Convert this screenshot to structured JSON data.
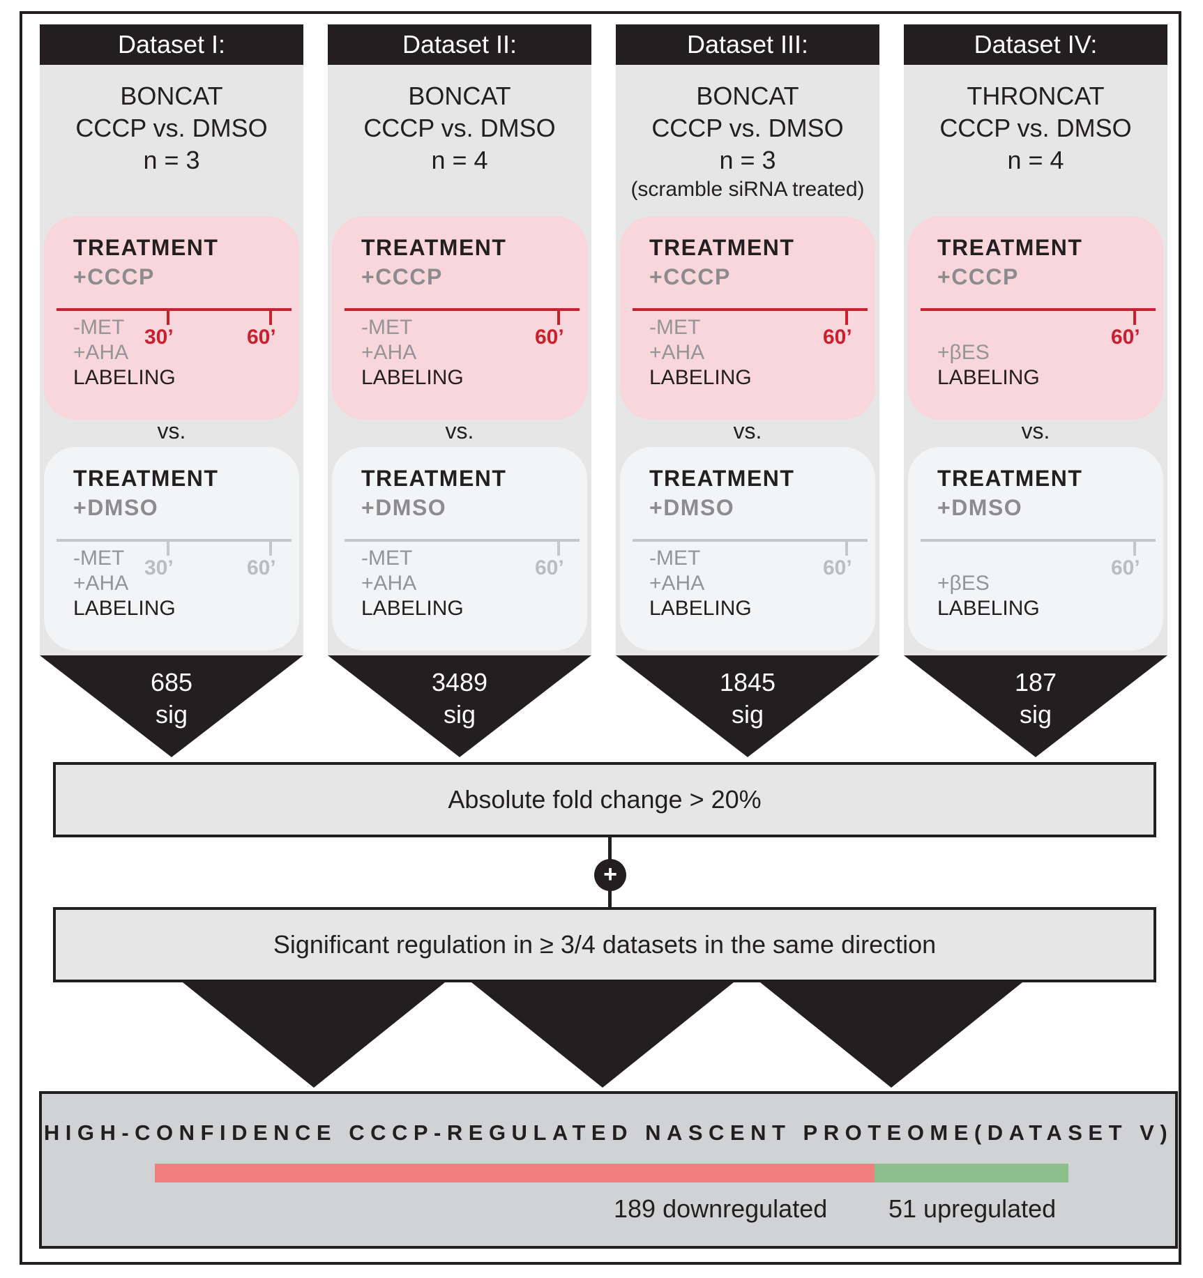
{
  "datasets": [
    {
      "header": "Dataset I:",
      "method": "BONCAT",
      "comparison": "CCCP vs. DMSO",
      "n": "n = 3",
      "note": "",
      "cccp": {
        "title": "TREATMENT",
        "agent": "+CCCP",
        "label_lines": [
          "-MET",
          "+AHA",
          "LABELING"
        ],
        "times": [
          "30’",
          "60’"
        ]
      },
      "vs": "vs.",
      "dmso": {
        "title": "TREATMENT",
        "agent": "+DMSO",
        "label_lines": [
          "-MET",
          "+AHA",
          "LABELING"
        ],
        "times": [
          "30’",
          "60’"
        ]
      },
      "sig_count": "685",
      "sig_label": "sig"
    },
    {
      "header": "Dataset II:",
      "method": "BONCAT",
      "comparison": "CCCP vs. DMSO",
      "n": "n = 4",
      "note": "",
      "cccp": {
        "title": "TREATMENT",
        "agent": "+CCCP",
        "label_lines": [
          "-MET",
          "+AHA",
          "LABELING"
        ],
        "times": [
          "60’"
        ]
      },
      "vs": "vs.",
      "dmso": {
        "title": "TREATMENT",
        "agent": "+DMSO",
        "label_lines": [
          "-MET",
          "+AHA",
          "LABELING"
        ],
        "times": [
          "60’"
        ]
      },
      "sig_count": "3489",
      "sig_label": "sig"
    },
    {
      "header": "Dataset III:",
      "method": "BONCAT",
      "comparison": "CCCP vs. DMSO",
      "n": "n = 3",
      "note": "(scramble siRNA treated)",
      "cccp": {
        "title": "TREATMENT",
        "agent": "+CCCP",
        "label_lines": [
          "-MET",
          "+AHA",
          "LABELING"
        ],
        "times": [
          "60’"
        ]
      },
      "vs": "vs.",
      "dmso": {
        "title": "TREATMENT",
        "agent": "+DMSO",
        "label_lines": [
          "-MET",
          "+AHA",
          "LABELING"
        ],
        "times": [
          "60’"
        ]
      },
      "sig_count": "1845",
      "sig_label": "sig"
    },
    {
      "header": "Dataset IV:",
      "method": "THRONCAT",
      "comparison": "CCCP vs. DMSO",
      "n": "n = 4",
      "note": "",
      "cccp": {
        "title": "TREATMENT",
        "agent": "+CCCP",
        "label_lines": [
          "",
          "+βES",
          "LABELING"
        ],
        "times": [
          "60’"
        ]
      },
      "vs": "vs.",
      "dmso": {
        "title": "TREATMENT",
        "agent": "+DMSO",
        "label_lines": [
          "",
          "+βES",
          "LABELING"
        ],
        "times": [
          "60’"
        ]
      },
      "sig_count": "187",
      "sig_label": "sig"
    }
  ],
  "filters": {
    "fold_change": "Absolute fold change > 20%",
    "combine_symbol": "+",
    "consistency": "Significant regulation in ≥ 3/4 datasets in the same direction"
  },
  "result": {
    "title": "HIGH-CONFIDENCE CCCP-REGULATED NASCENT PROTEOME(DATASET V)",
    "downregulated": 189,
    "upregulated": 51,
    "downregulated_label": "189 downregulated",
    "upregulated_label": "51 upregulated",
    "down_color": "#f07f7e",
    "up_color": "#8dbf8c"
  },
  "colors": {
    "header_bg": "#231f20",
    "panel_bg": "#e6e6e7",
    "treatment_card": "#f9d6dc",
    "control_card": "#f3f4f5",
    "treatment_accent": "#c8202f",
    "control_accent": "#c6c7c9"
  }
}
